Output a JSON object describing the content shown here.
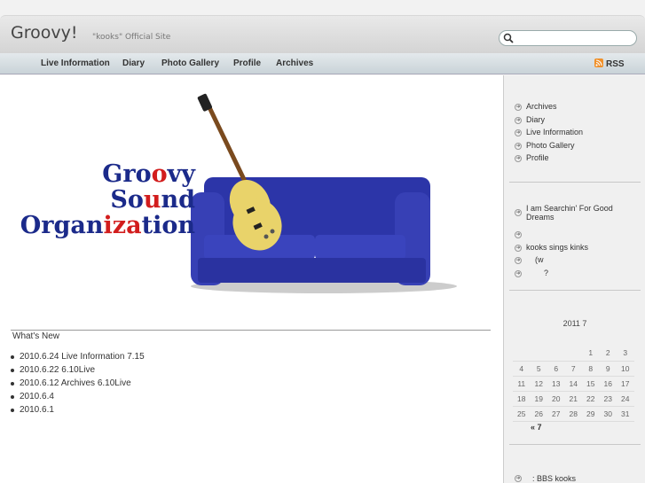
{
  "header": {
    "title": "Groovy!",
    "description": "\"kooks\"   Official Site",
    "search_placeholder": ""
  },
  "nav": {
    "items": [
      "Live Information",
      "Diary",
      "Photo Gallery",
      "Profile",
      "Archives"
    ],
    "rss": "RSS"
  },
  "banner": {
    "line1_a": "Gro",
    "line1_b": "o",
    "line1_c": "vy",
    "line2_a": "So",
    "line2_b": "u",
    "line2_c": "nd",
    "line3_a": "Organ",
    "line3_b": "iza",
    "line3_c": "tion"
  },
  "whats_new": {
    "title": "What's New",
    "items": [
      "2010.6.24  Live Information 7.15",
      "2010.6.22  6.10Live",
      "2010.6.12   Archives      6.10Live",
      "2010.6.4",
      "2010.6.1"
    ]
  },
  "sidebar": {
    "categories": [
      "Archives",
      "Diary",
      "Live Information",
      "Photo Gallery",
      "Profile"
    ],
    "recent": [
      "I am Searchin' For Good Dreams",
      "",
      "kooks sings kinks",
      "    (w",
      "        ?"
    ],
    "calendar_title": "2011 7",
    "calendar_rows": [
      [
        "",
        "",
        "",
        "",
        "1",
        "2",
        "3"
      ],
      [
        "4",
        "5",
        "6",
        "7",
        "8",
        "9",
        "10"
      ],
      [
        "11",
        "12",
        "13",
        "14",
        "15",
        "16",
        "17"
      ],
      [
        "18",
        "19",
        "20",
        "21",
        "22",
        "23",
        "24"
      ],
      [
        "25",
        "26",
        "27",
        "28",
        "29",
        "30",
        "31"
      ]
    ],
    "calendar_prev": "« 7",
    "bbs": ": BBS   kooks"
  }
}
